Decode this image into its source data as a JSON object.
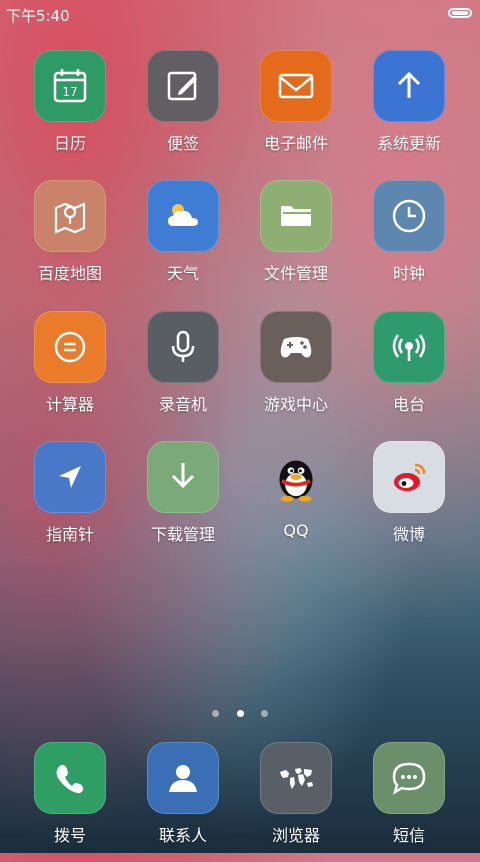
{
  "status_bar": {
    "time": "下午5:40"
  },
  "apps": [
    {
      "name": "calendar",
      "label": "日历",
      "icon": "calendar-icon",
      "color": "#2f9a66",
      "date": "17"
    },
    {
      "name": "notes",
      "label": "便签",
      "icon": "edit-icon",
      "color": "#615f63"
    },
    {
      "name": "email",
      "label": "电子邮件",
      "icon": "envelope-icon",
      "color": "#e56b1c"
    },
    {
      "name": "system-update",
      "label": "系统更新",
      "icon": "arrow-up-icon",
      "color": "#3c74d3"
    },
    {
      "name": "baidu-map",
      "label": "百度地图",
      "icon": "map-pin-icon",
      "color": "#c9896a"
    },
    {
      "name": "weather",
      "label": "天气",
      "icon": "weather-icon",
      "color": "#3f7dd4"
    },
    {
      "name": "file-manager",
      "label": "文件管理",
      "icon": "folder-icon",
      "color": "#8fae74"
    },
    {
      "name": "clock",
      "label": "时钟",
      "icon": "clock-icon",
      "color": "#5d87ae"
    },
    {
      "name": "calculator",
      "label": "计算器",
      "icon": "calculator-icon",
      "color": "#ea7b2a"
    },
    {
      "name": "recorder",
      "label": "录音机",
      "icon": "microphone-icon",
      "color": "#595d64"
    },
    {
      "name": "game-center",
      "label": "游戏中心",
      "icon": "gamepad-icon",
      "color": "#6a5f5b"
    },
    {
      "name": "radio",
      "label": "电台",
      "icon": "radio-icon",
      "color": "#2f9b6d"
    },
    {
      "name": "compass",
      "label": "指南针",
      "icon": "navigation-icon",
      "color": "#4a78c8"
    },
    {
      "name": "download-manager",
      "label": "下载管理",
      "icon": "download-icon",
      "color": "#7ca979"
    },
    {
      "name": "qq",
      "label": "QQ",
      "icon": "qq-penguin-icon",
      "color": "transparent"
    },
    {
      "name": "weibo",
      "label": "微博",
      "icon": "weibo-icon",
      "color": "#d8dce3"
    }
  ],
  "page_indicator": {
    "pages": 3,
    "active": 2
  },
  "dock": [
    {
      "name": "dialer",
      "label": "拨号",
      "icon": "phone-icon",
      "color": "#2e9e64"
    },
    {
      "name": "contacts",
      "label": "联系人",
      "icon": "contact-icon",
      "color": "#3a6fb6"
    },
    {
      "name": "browser",
      "label": "浏览器",
      "icon": "world-map-icon",
      "color": "#595f66"
    },
    {
      "name": "sms",
      "label": "短信",
      "icon": "chat-bubble-icon",
      "color": "#6c8f6b"
    }
  ]
}
